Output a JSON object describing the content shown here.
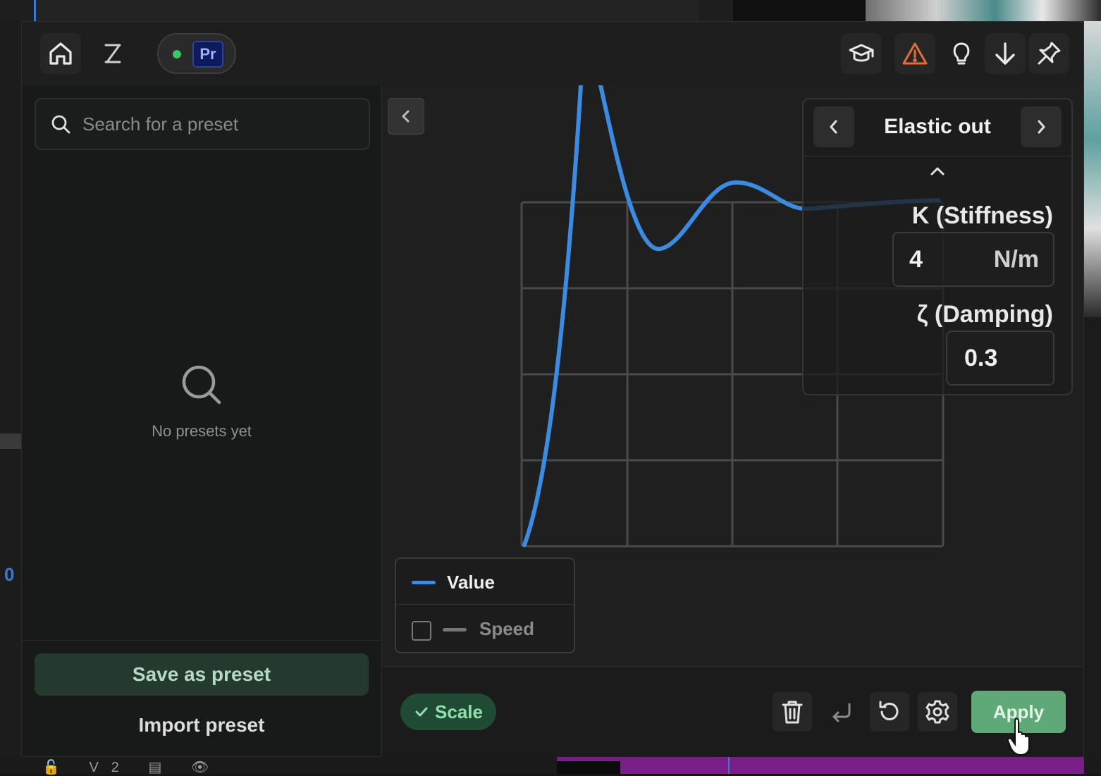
{
  "host": {
    "timecode_fragment": "0"
  },
  "topbar": {
    "premiere_badge": "Pr",
    "connected_color": "#3cc46a"
  },
  "sidebar": {
    "search": {
      "placeholder": "Search for a preset",
      "value": ""
    },
    "empty_state": "No presets yet",
    "save_button": "Save as preset",
    "import_button": "Import preset"
  },
  "graph": {
    "curve_color": "#3b8be3",
    "legend": {
      "value_label": "Value",
      "speed_label": "Speed",
      "speed_checked": false
    }
  },
  "preset_panel": {
    "title": "Elastic out",
    "stiffness_label": "K (Stiffness)",
    "stiffness_value": "4",
    "stiffness_unit": "N/m",
    "damping_label": "ζ (Damping)",
    "damping_value": "0.3"
  },
  "bottombar": {
    "scale_label": "Scale",
    "scale_enabled": true,
    "apply_label": "Apply"
  },
  "colors": {
    "accent_green": "#5fa877",
    "curve_blue": "#3b8be3",
    "warning_orange": "#e0703a"
  }
}
